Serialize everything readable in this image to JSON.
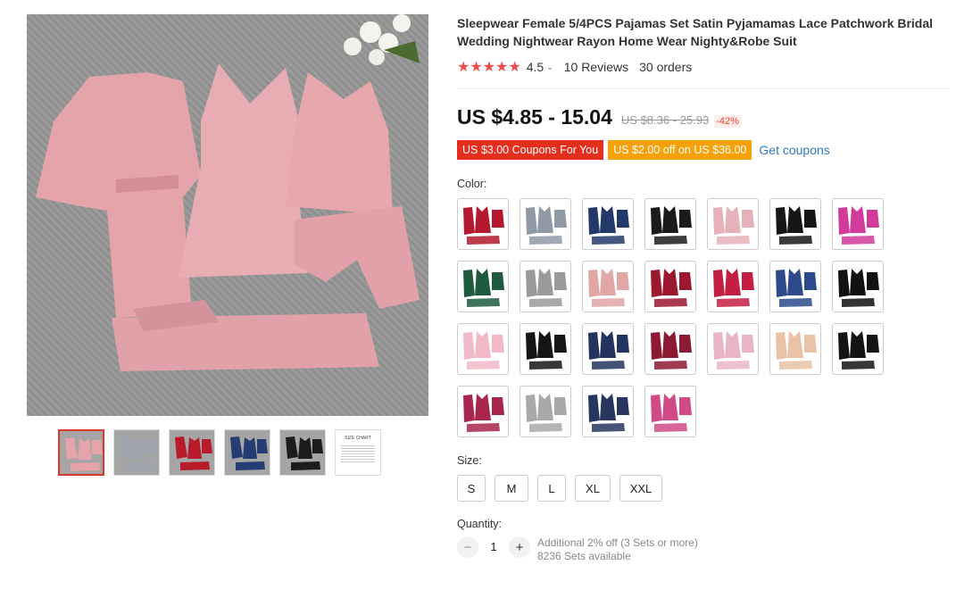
{
  "product": {
    "title": "Sleepwear Female 5/4PCS Pajamas Set Satin Pyjamamas Lace Patchwork Bridal Wedding Nightwear Rayon Home Wear Nighty&Robe Suit",
    "main_image_color": "#e4a4aa",
    "thumbnails": [
      {
        "name": "pink",
        "color": "#e4a4aa"
      },
      {
        "name": "gray",
        "color": "#9fa4ad"
      },
      {
        "name": "red",
        "color": "#b71b2c"
      },
      {
        "name": "navy",
        "color": "#243d72"
      },
      {
        "name": "black",
        "color": "#1c1c1c"
      },
      {
        "name": "size-chart",
        "color": "#ffffff",
        "text": "SIZE CHART"
      }
    ]
  },
  "rating": {
    "stars": "★★★★★",
    "score": "4.5",
    "caret": "⌄",
    "reviews": "10 Reviews",
    "orders": "30 orders"
  },
  "price": {
    "current": "US $4.85 - 15.04",
    "original": "US $8.36 - 25.93",
    "discount": "-42%"
  },
  "coupons": {
    "red": "US $3.00 Coupons For You",
    "orange": "US $2.00 off on US $36.00",
    "link": "Get coupons"
  },
  "colors": {
    "label": "Color:",
    "swatches": [
      "#b3182e",
      "#8f9aa6",
      "#23396a",
      "#1b1b1b",
      "#e7b1b9",
      "#161616",
      "#d23a9c",
      "#1d5a3e",
      "#9a9a9a",
      "#e0a7a5",
      "#9c1830",
      "#c41f42",
      "#2c4a8c",
      "#111111",
      "#f2b9c8",
      "#151515",
      "#23345e",
      "#8c1a33",
      "#e9b5c6",
      "#e9c2a8",
      "#141414",
      "#a8264e",
      "#a9a9a9",
      "#27355f",
      "#d04a87"
    ]
  },
  "sizes": {
    "label": "Size:",
    "options": [
      "S",
      "M",
      "L",
      "XL",
      "XXL"
    ]
  },
  "quantity": {
    "label": "Quantity:",
    "minus": "−",
    "value": "1",
    "plus": "+",
    "offer": "Additional 2% off (3 Sets or more)",
    "available": "8236 Sets available"
  }
}
